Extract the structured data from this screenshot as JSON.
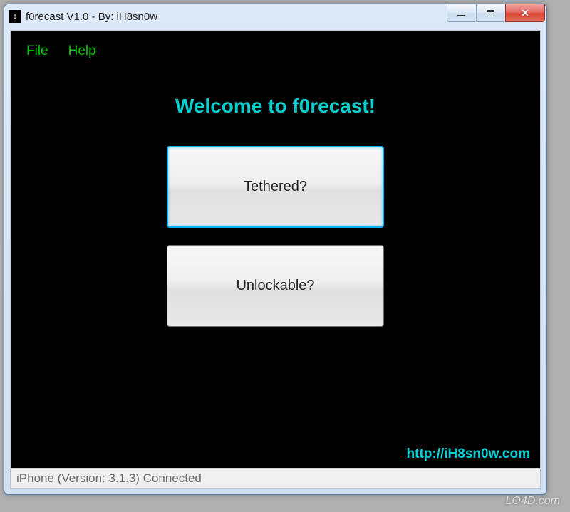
{
  "window": {
    "title": "f0recast V1.0 - By: iH8sn0w",
    "icon_char": "↕"
  },
  "menu": {
    "file": "File",
    "help": "Help"
  },
  "content": {
    "welcome": "Welcome to f0recast!",
    "tethered_button": "Tethered?",
    "unlockable_button": "Unlockable?",
    "link": "http://iH8sn0w.com"
  },
  "status": {
    "text": "iPhone (Version: 3.1.3) Connected"
  },
  "watermark": "LO4D.com"
}
